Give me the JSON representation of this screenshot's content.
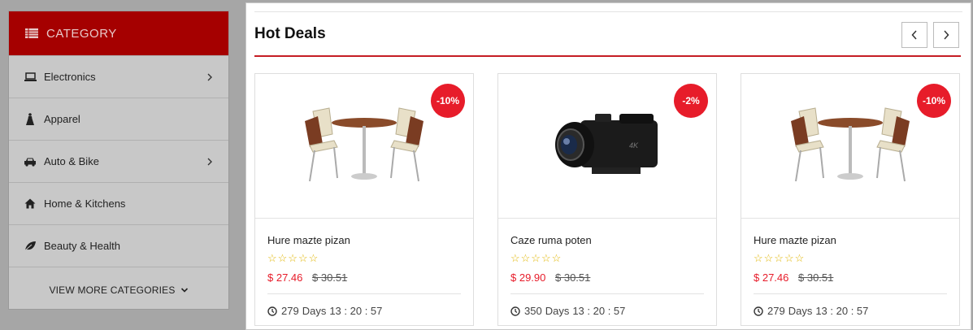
{
  "sidebar": {
    "header": "CATEGORY",
    "items": [
      {
        "label": "Electronics",
        "icon": "laptop-icon",
        "has_sub": true
      },
      {
        "label": "Apparel",
        "icon": "dress-icon",
        "has_sub": false
      },
      {
        "label": "Auto & Bike",
        "icon": "car-icon",
        "has_sub": true
      },
      {
        "label": "Home & Kitchens",
        "icon": "home-icon",
        "has_sub": false
      },
      {
        "label": "Beauty & Health",
        "icon": "leaf-icon",
        "has_sub": false
      }
    ],
    "view_more": "VIEW MORE CATEGORIES"
  },
  "deals": {
    "title": "Hot Deals",
    "products": [
      {
        "name": "Hure mazte pizan",
        "discount": "-10%",
        "stars": "☆☆☆☆☆",
        "price": "$ 27.46",
        "old_price": "$ 30.51",
        "count": "279",
        "days_label": "Days",
        "time": "13 : 20 : 57",
        "image": "table-chairs"
      },
      {
        "name": "Caze ruma poten",
        "discount": "-2%",
        "stars": "☆☆☆☆☆",
        "price": "$ 29.90",
        "old_price": "$ 30.51",
        "count": "350",
        "days_label": "Days",
        "time": "13 : 20 : 57",
        "image": "camcorder"
      },
      {
        "name": "Hure mazte pizan",
        "discount": "-10%",
        "stars": "☆☆☆☆☆",
        "price": "$ 27.46",
        "old_price": "$ 30.51",
        "count": "279",
        "days_label": "Days",
        "time": "13 : 20 : 57",
        "image": "table-chairs"
      }
    ]
  },
  "colors": {
    "accent": "#c51d24",
    "badge": "#e71c2a",
    "header_bg": "#a50000",
    "star": "#e0b500"
  }
}
